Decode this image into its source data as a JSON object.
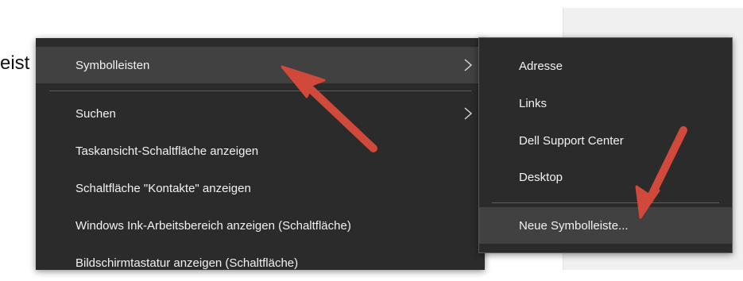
{
  "background": {
    "text": "eist"
  },
  "context_menu": {
    "items": [
      {
        "label": "Symbolleisten",
        "has_submenu": true,
        "highlighted": true
      },
      {
        "label": "Suchen",
        "has_submenu": true
      },
      {
        "label": "Taskansicht-Schaltfläche anzeigen"
      },
      {
        "label": "Schaltfläche \"Kontakte\" anzeigen"
      },
      {
        "label": "Windows Ink-Arbeitsbereich anzeigen (Schaltfläche)"
      },
      {
        "label": "Bildschirmtastatur anzeigen (Schaltfläche)"
      }
    ]
  },
  "submenu": {
    "items": [
      {
        "label": "Adresse"
      },
      {
        "label": "Links"
      },
      {
        "label": "Dell Support Center"
      },
      {
        "label": "Desktop"
      },
      {
        "label": "Neue Symbolleiste...",
        "highlighted": true
      }
    ]
  },
  "colors": {
    "menu_bg": "#2b2b2b",
    "menu_highlight": "#414141",
    "menu_text": "#f2f2f2",
    "annotation_arrow": "#d0493a"
  },
  "icons": {
    "submenu_indicator": "chevron-right-icon",
    "annotation": "arrow-annotation"
  }
}
